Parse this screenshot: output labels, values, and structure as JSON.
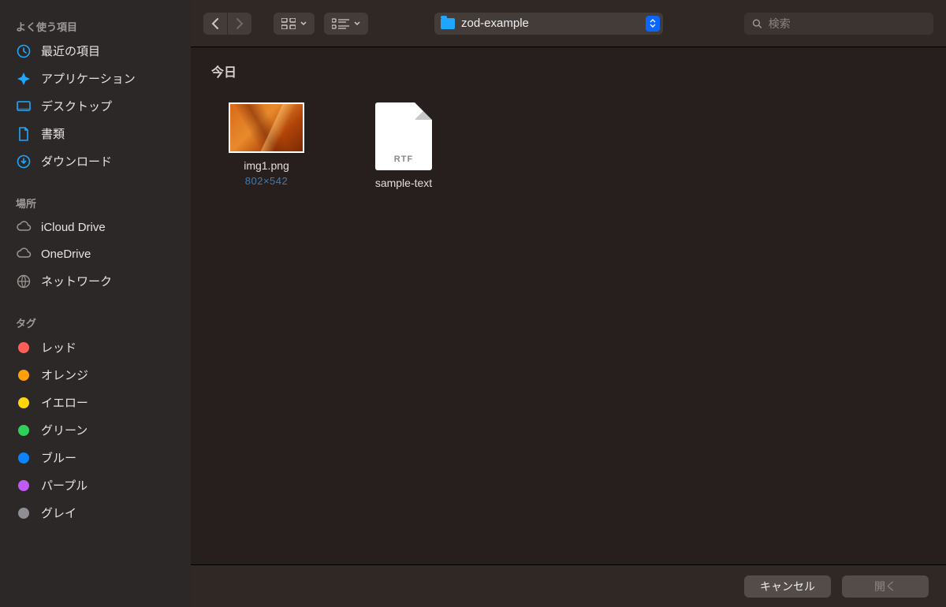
{
  "sidebar": {
    "favorites_header": "よく使う項目",
    "favorites": [
      {
        "key": "recents",
        "label": "最近の項目",
        "icon": "clock"
      },
      {
        "key": "applications",
        "label": "アプリケーション",
        "icon": "apps"
      },
      {
        "key": "desktop",
        "label": "デスクトップ",
        "icon": "desktop"
      },
      {
        "key": "documents",
        "label": "書類",
        "icon": "doc"
      },
      {
        "key": "downloads",
        "label": "ダウンロード",
        "icon": "download"
      }
    ],
    "locations_header": "場所",
    "locations": [
      {
        "key": "icloud",
        "label": "iCloud Drive",
        "icon": "cloud"
      },
      {
        "key": "onedrive",
        "label": "OneDrive",
        "icon": "cloud"
      },
      {
        "key": "network",
        "label": "ネットワーク",
        "icon": "globe"
      }
    ],
    "tags_header": "タグ",
    "tags": [
      {
        "label": "レッド",
        "color": "#ff5f57"
      },
      {
        "label": "オレンジ",
        "color": "#ff9f0a"
      },
      {
        "label": "イエロー",
        "color": "#ffd60a"
      },
      {
        "label": "グリーン",
        "color": "#30d158"
      },
      {
        "label": "ブルー",
        "color": "#0a84ff"
      },
      {
        "label": "パープル",
        "color": "#bf5af2"
      },
      {
        "label": "グレイ",
        "color": "#8e8e93"
      }
    ]
  },
  "toolbar": {
    "current_folder": "zod-example",
    "search_placeholder": "検索"
  },
  "content": {
    "section": "今日",
    "files": [
      {
        "name": "img1.png",
        "type": "image",
        "meta": "802×542"
      },
      {
        "name": "sample-text",
        "type": "rtf",
        "badge": "RTF"
      }
    ]
  },
  "footer": {
    "cancel": "キャンセル",
    "open": "開く"
  }
}
